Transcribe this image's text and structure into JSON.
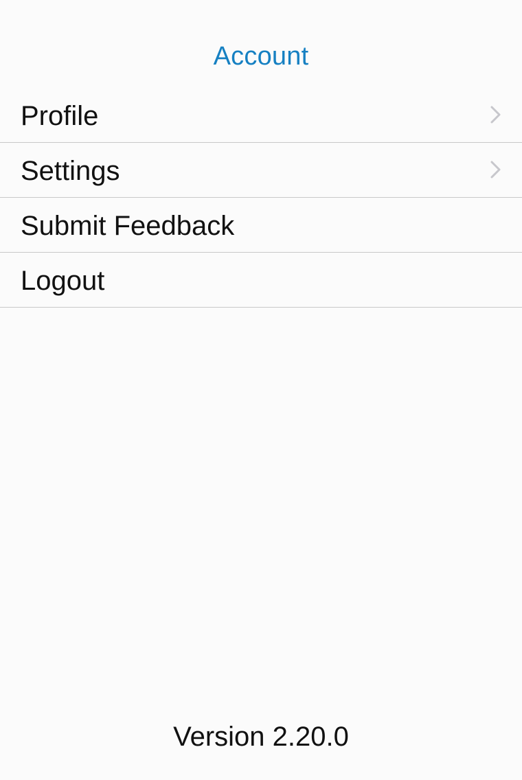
{
  "header": {
    "title": "Account",
    "title_color": "#1680c2"
  },
  "menu": {
    "items": [
      {
        "label": "Profile",
        "has_chevron": true,
        "icon": "chevron-right-icon"
      },
      {
        "label": "Settings",
        "has_chevron": true,
        "icon": "chevron-right-icon"
      },
      {
        "label": "Submit Feedback",
        "has_chevron": false
      },
      {
        "label": "Logout",
        "has_chevron": false
      }
    ],
    "separator_color": "#c8c8c8",
    "chevron_color": "#c7c7cc"
  },
  "footer": {
    "version": "Version 2.20.0"
  },
  "theme": {
    "background": "#fbfbfb",
    "text_color": "#111111"
  }
}
